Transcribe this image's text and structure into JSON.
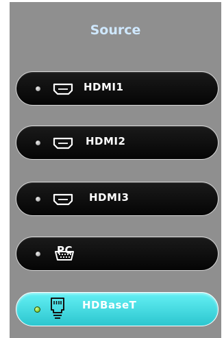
{
  "menu": {
    "title": "Source",
    "items": [
      {
        "label": "HDMI1",
        "icon": "hdmi-port-icon",
        "selected": false
      },
      {
        "label": "HDMI2",
        "icon": "hdmi-port-icon",
        "selected": false
      },
      {
        "label": "HDMI3",
        "icon": "hdmi-port-icon",
        "selected": false
      },
      {
        "label": "PC",
        "icon": "vga-port-icon",
        "selected": false
      },
      {
        "label": "HDBaseT",
        "icon": "rj45-port-icon",
        "selected": true
      }
    ]
  },
  "colors": {
    "panel": "#8f8f8f",
    "title": "#cfe8ff",
    "button": "#0d0d0d",
    "selected_button": "#3fd8de",
    "selected_indicator": "#58b000"
  }
}
